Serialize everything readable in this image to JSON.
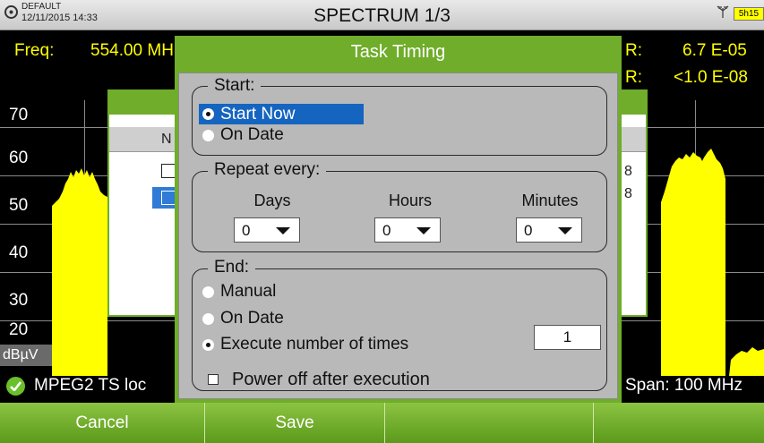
{
  "topbar": {
    "profile_name": "DEFAULT",
    "datetime": "12/11/2015 14:33",
    "title": "SPECTRUM 1/3",
    "battery": "5h15"
  },
  "measures": {
    "freq_label": "Freq:",
    "freq_value": "554.00 MH",
    "ber1_label": "R:",
    "ber1_value": "6.7 E-05",
    "ber2_label": "R:",
    "ber2_value": "<1.0 E-08"
  },
  "plot": {
    "y_ticks": [
      "70",
      "60",
      "50",
      "40",
      "30",
      "20"
    ],
    "unit": "dBµV",
    "trace_color": "#ffff00"
  },
  "status": {
    "lock_text": "MPEG2 TS loc",
    "span_text": "Span: 100 MHz"
  },
  "background_dialog": {
    "col_header": "N",
    "row_values": [
      "8",
      "8"
    ]
  },
  "dialog": {
    "title": "Task Timing",
    "start": {
      "legend": "Start:",
      "options": [
        "Start Now",
        "On Date"
      ],
      "selected": "Start Now"
    },
    "repeat": {
      "legend": "Repeat every:",
      "days_label": "Days",
      "hours_label": "Hours",
      "minutes_label": "Minutes",
      "days_value": "0",
      "hours_value": "0",
      "minutes_value": "0"
    },
    "end": {
      "legend": "End:",
      "options": [
        "Manual",
        "On Date",
        "Execute number of times"
      ],
      "selected": "Execute number of times",
      "times_value": "1"
    },
    "power_off_label": "Power off after execution"
  },
  "softkeys": [
    "Cancel",
    "Save",
    "",
    ""
  ],
  "colors": {
    "accent_green": "#6fad2a",
    "selection_blue": "#1565c0",
    "trace_yellow": "#ffff00"
  }
}
